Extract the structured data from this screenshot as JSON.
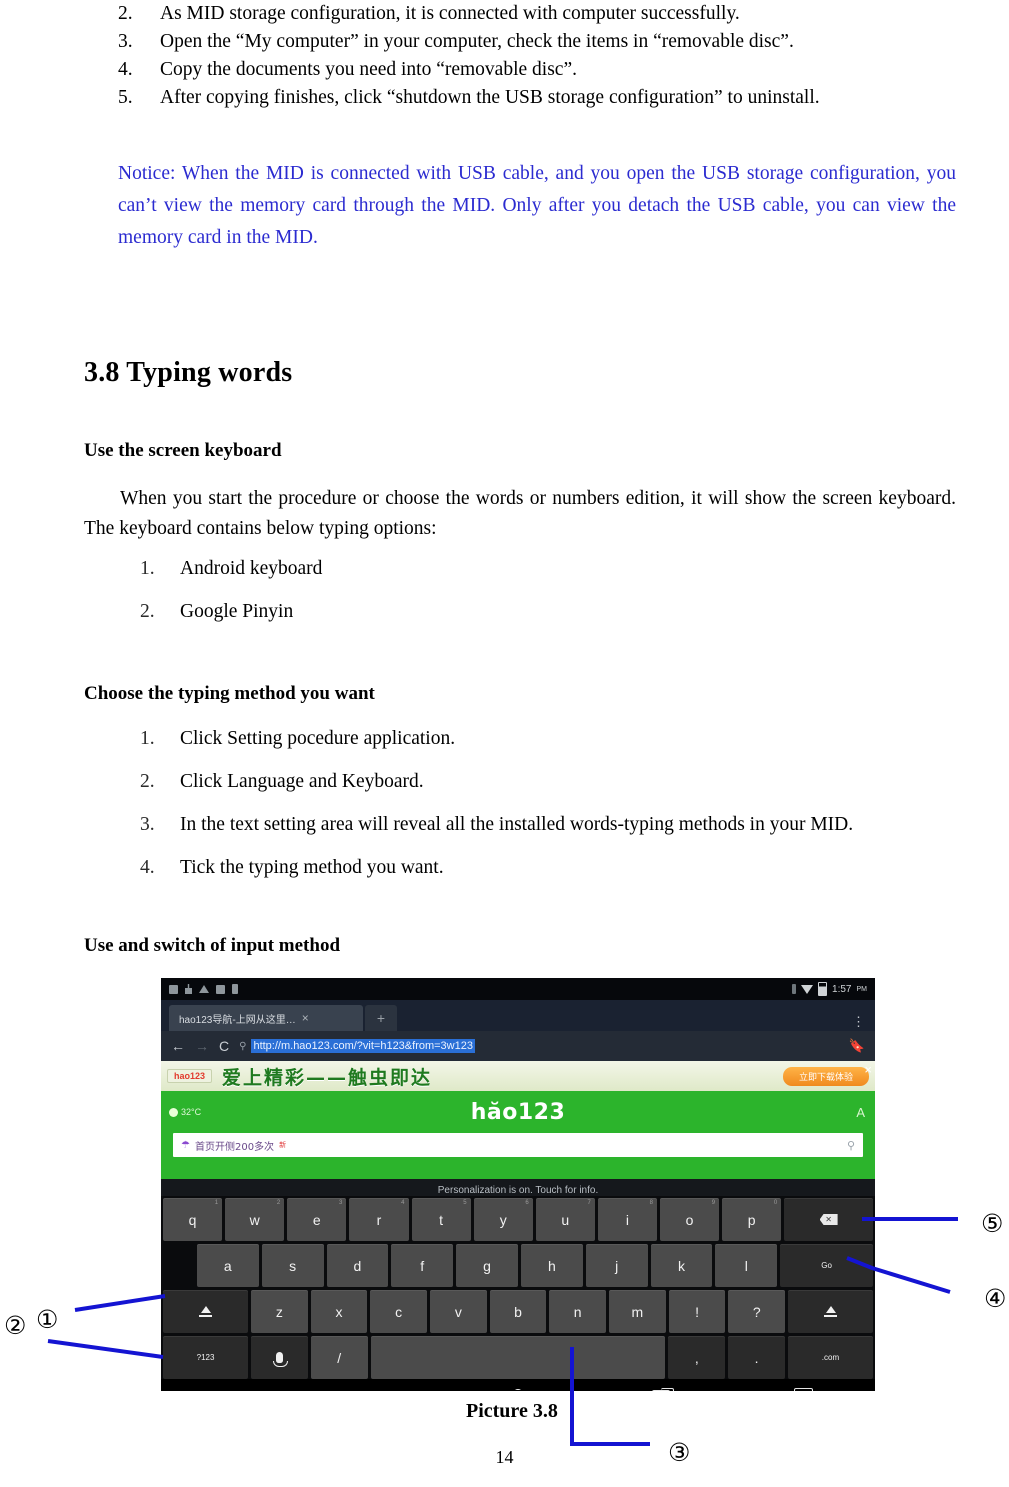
{
  "top_list": [
    {
      "num": "2.",
      "text": "As MID storage configuration, it is connected with computer successfully."
    },
    {
      "num": "3.",
      "text": "Open the “My computer” in your computer, check the items in “removable disc”."
    },
    {
      "num": "4.",
      "text": "Copy the documents you need into “removable disc”."
    },
    {
      "num": "5.",
      "text": "After copying finishes, click “shutdown the USB storage configuration” to uninstall."
    }
  ],
  "notice": {
    "text": "Notice: When the MID is connected with USB cable, and you open the USB storage configuration, you can’t view the memory card through the MID. Only after you detach the USB cable, you can view the memory card in the MID.",
    "color": "#2b2bd0"
  },
  "section": {
    "heading": "3.8 Typing words",
    "subhead_screen_keyboard": "Use the screen keyboard",
    "subhead_choose_method": "Choose the typing method you want",
    "subhead_use_switch": "Use and switch of input method",
    "intro_paragraph": "When you start the procedure or choose the words or numbers edition, it will show the screen keyboard. The keyboard contains below typing options:"
  },
  "keyboard_options": [
    {
      "num": "1.",
      "text": "Android keyboard"
    },
    {
      "num": "2.",
      "text": "Google Pinyin"
    }
  ],
  "method_steps": [
    {
      "num": "1.",
      "text": "Click Setting pocedure application."
    },
    {
      "num": "2.",
      "text": "Click Language and Keyboard."
    },
    {
      "num": "3.",
      "text": "In the text setting area will reveal all the installed words-typing methods in your MID."
    },
    {
      "num": "4.",
      "text": "Tick the typing method you want."
    }
  ],
  "screenshot": {
    "statusbar": {
      "time": "1:57",
      "ampm": "PM"
    },
    "browser": {
      "tab_title": "hao123导航-上网从这里…",
      "tab_close": "×",
      "tab_new": "+",
      "menu": "⋮",
      "back": "←",
      "forward": "→",
      "reload": "C",
      "url": "http://m.hao123.com/?vit=h123&from=3w123",
      "bookmark": "🔖"
    },
    "webpage": {
      "ad_logo": "hao123",
      "ad_text": "爱上精彩——触虫即达",
      "ad_button": "立即下载体验",
      "ad_close": "×",
      "weather": "32°C",
      "logo": "hăo123",
      "user": "A",
      "search_hot": "首页开侧200多次",
      "search_badge": "新",
      "personalization": "Personalization is on. Touch for info."
    },
    "keyboard": {
      "row1": [
        {
          "label": "q",
          "alt": "1"
        },
        {
          "label": "w",
          "alt": "2"
        },
        {
          "label": "e",
          "alt": "3"
        },
        {
          "label": "r",
          "alt": "4"
        },
        {
          "label": "t",
          "alt": "5"
        },
        {
          "label": "y",
          "alt": "6"
        },
        {
          "label": "u",
          "alt": "7"
        },
        {
          "label": "i",
          "alt": "8"
        },
        {
          "label": "o",
          "alt": "9"
        },
        {
          "label": "p",
          "alt": "0"
        }
      ],
      "row1_action": "backspace",
      "row2": [
        "a",
        "s",
        "d",
        "f",
        "g",
        "h",
        "j",
        "k",
        "l"
      ],
      "row2_action": "Go",
      "row3": [
        "z",
        "x",
        "c",
        "v",
        "b",
        "n",
        "m",
        "!",
        "?"
      ],
      "row3_shift": "shift",
      "row4": {
        "symbols": "?123",
        "mic": "mic",
        "slash": "/",
        "space": "",
        "comma": ",",
        "period": ".",
        "dotcom": ".com"
      }
    },
    "navbar": [
      "up-icon",
      "hide-keyboard-icon",
      "home-icon",
      "recents-icon",
      "keyboard-switch-icon"
    ]
  },
  "annotations": {
    "one": "①",
    "two": "②",
    "three": "③",
    "four": "④",
    "five": "⑤",
    "leader_color": "#1414d2"
  },
  "caption": "Picture 3.8",
  "page_number": "14"
}
